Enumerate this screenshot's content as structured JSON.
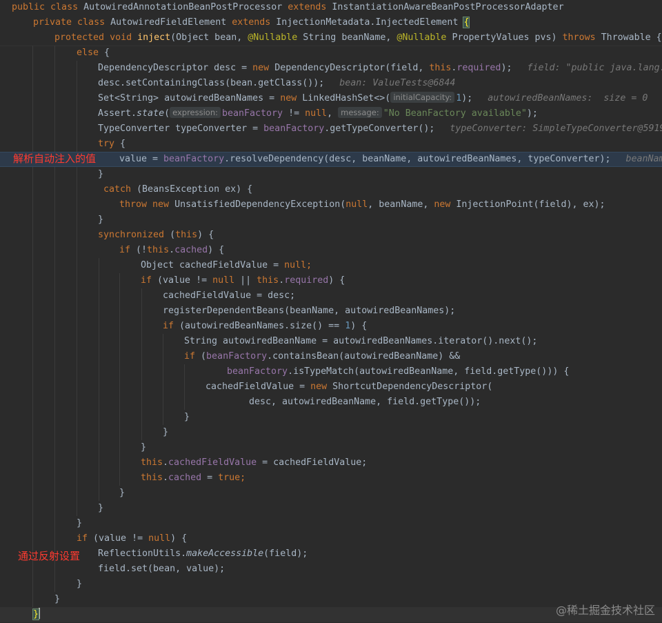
{
  "lines": {
    "l1": {
      "a": "public ",
      "b": "class ",
      "c": "AutowiredAnnotationBeanPostProcessor ",
      "d": "extends ",
      "e": "InstantiationAwareBeanPostProcessorAdapter"
    },
    "l2": {
      "a": "private ",
      "b": "class ",
      "c": "AutowiredFieldElement ",
      "d": "extends ",
      "e": "InjectionMetadata.InjectedElement ",
      "f": "{"
    },
    "l3": {
      "a": "protected ",
      "b": "void ",
      "c": "inject",
      "d": "(Object bean, ",
      "e": "@Nullable ",
      "f": "String beanName, ",
      "g": "@Nullable ",
      "h": "PropertyValues pvs) ",
      "i": "throws ",
      "j": "Throwable {"
    },
    "l4": {
      "a": "else ",
      "b": "{"
    },
    "l5": {
      "a": "DependencyDescriptor desc = ",
      "b": "new ",
      "c": "DependencyDescriptor(field, ",
      "d": "this",
      "e": ".",
      "f": "required",
      "g": ");",
      "h": "field: \"public java.lang.St"
    },
    "l6": {
      "a": "desc.setContainingClass(bean.getClass());",
      "b": "bean: ValueTests@6844"
    },
    "l7": {
      "a": "Set<String> autowiredBeanNames = ",
      "b": "new ",
      "c": "LinkedHashSet<>(",
      "d": "initialCapacity:",
      "e": "1",
      "f": ");",
      "g": "autowiredBeanNames:  size = 0"
    },
    "l8": {
      "a": "Assert.",
      "b": "state",
      "c": "(",
      "d": "expression:",
      "e": "beanFactory ",
      "f": "!= ",
      "g": "null",
      "h": ", ",
      "i": "message:",
      "j": "\"No BeanFactory available\"",
      "k": ");"
    },
    "l9": {
      "a": "TypeConverter typeConverter = ",
      "b": "beanFactory",
      "c": ".getTypeConverter();",
      "d": "typeConverter: SimpleTypeConverter@5919"
    },
    "l10": {
      "a": "try ",
      "b": "{"
    },
    "l11": {
      "a": "value = ",
      "b": "beanFactory",
      "c": ".resolveDependency(desc, beanName, autowiredBeanNames, typeConverter);",
      "d": "beanName:"
    },
    "l12": {
      "a": "}"
    },
    "l13": {
      "a": "catch ",
      "b": "(BeansException ex) {"
    },
    "l14": {
      "a": "throw ",
      "b": "new ",
      "c": "UnsatisfiedDependencyException(",
      "d": "null",
      "e": ", beanName, ",
      "f": "new ",
      "g": "InjectionPoint(field), ex);"
    },
    "l15": {
      "a": "}"
    },
    "l16": {
      "a": "synchronized ",
      "b": "(",
      "c": "this",
      "d": ") {"
    },
    "l17": {
      "a": "if ",
      "b": "(!",
      "c": "this",
      "d": ".",
      "e": "cached",
      "f": ") {"
    },
    "l18": {
      "a": "Object cachedFieldValue = ",
      "b": "null",
      "c": ";"
    },
    "l19": {
      "a": "if ",
      "b": "(value != ",
      "c": "null ",
      "d": "|| ",
      "e": "this",
      "f": ".",
      "g": "required",
      "h": ") {"
    },
    "l20": {
      "a": "cachedFieldValue = desc;"
    },
    "l21": {
      "a": "registerDependentBeans(beanName, autowiredBeanNames);"
    },
    "l22": {
      "a": "if ",
      "b": "(autowiredBeanNames.size() == ",
      "c": "1",
      "d": ") {"
    },
    "l23": {
      "a": "String autowiredBeanName = autowiredBeanNames.iterator().next();"
    },
    "l24": {
      "a": "if ",
      "b": "(",
      "c": "beanFactory",
      "d": ".containsBean(autowiredBeanName) &&"
    },
    "l25": {
      "a": "beanFactory",
      "b": ".isTypeMatch(autowiredBeanName, field.getType())) {"
    },
    "l26": {
      "a": "cachedFieldValue = ",
      "b": "new ",
      "c": "ShortcutDependencyDescriptor("
    },
    "l27": {
      "a": "desc, autowiredBeanName, field.getType());"
    },
    "l28": {
      "a": "}"
    },
    "l29": {
      "a": "}"
    },
    "l30": {
      "a": "}"
    },
    "l31": {
      "a": "this",
      "b": ".",
      "c": "cachedFieldValue ",
      "d": "= cachedFieldValue;"
    },
    "l32": {
      "a": "this",
      "b": ".",
      "c": "cached ",
      "d": "= ",
      "e": "true",
      "f": ";"
    },
    "l33": {
      "a": "}"
    },
    "l34": {
      "a": "}"
    },
    "l35": {
      "a": "}"
    },
    "l36": {
      "a": "if ",
      "b": "(value != ",
      "c": "null",
      "d": ") {"
    },
    "l37": {
      "a": "ReflectionUtils.",
      "b": "makeAccessible",
      "c": "(field);"
    },
    "l38": {
      "a": "field.set(bean, value);"
    },
    "l39": {
      "a": "}"
    },
    "l40": {
      "a": "}"
    },
    "l41": {
      "a": "}"
    }
  },
  "annotations": {
    "resolve_label": "解析自动注入的值",
    "reflect_label": "通过反射设置"
  },
  "watermark": "@稀土掘金技术社区",
  "colors": {
    "background": "#2b2b2b",
    "keyword": "#cc7832",
    "field": "#9876aa",
    "method": "#ffc66d",
    "annotation": "#bbb529",
    "number": "#6897bb",
    "string": "#6a8759",
    "annotation_text": "#ff3b30"
  }
}
